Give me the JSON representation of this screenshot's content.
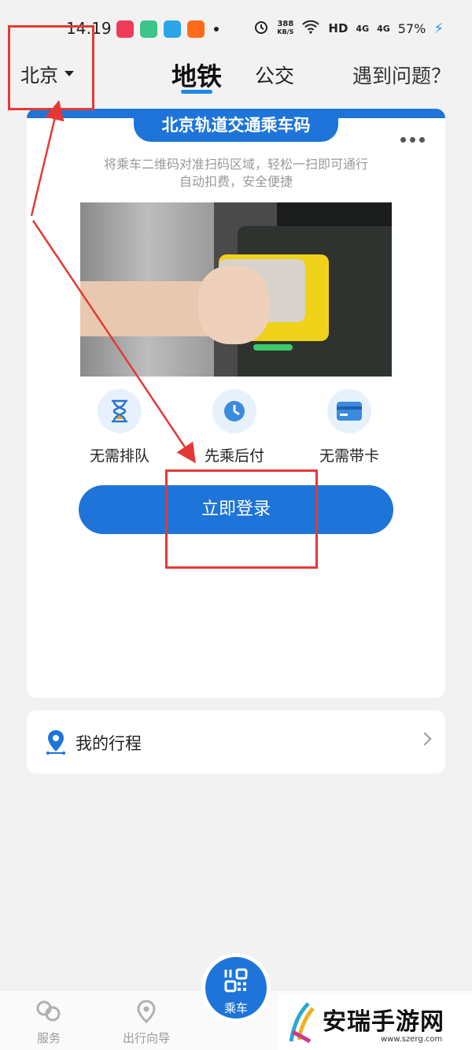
{
  "status_bar": {
    "time": "14:19",
    "speed_value": "388",
    "speed_unit": "KB/S",
    "network": "HD",
    "signal1": "4G",
    "signal2": "4G",
    "battery": "57%"
  },
  "header": {
    "city": "北京",
    "tabs": [
      {
        "label": "地铁",
        "active": true
      },
      {
        "label": "公交",
        "active": false
      }
    ],
    "help": "遇到问题？"
  },
  "card": {
    "banner": "北京轨道交通乘车码",
    "desc_line1": "将乘车二维码对准扫码区域，轻松一扫即可通行",
    "desc_line2": "自动扣费，安全便捷",
    "features": [
      {
        "label": "无需排队",
        "icon": "hourglass-icon"
      },
      {
        "label": "先乘后付",
        "icon": "clock-icon"
      },
      {
        "label": "无需带卡",
        "icon": "card-icon"
      }
    ],
    "login_button": "立即登录"
  },
  "trips": {
    "label": "我的行程"
  },
  "bottom_nav": {
    "items": [
      {
        "label": "服务",
        "icon": "service-icon"
      },
      {
        "label": "出行向导",
        "icon": "location-icon"
      }
    ],
    "center": {
      "label": "乘车",
      "icon": "qr-code-icon"
    }
  },
  "watermark": {
    "text": "安瑞手游网",
    "url": "www.szerg.com"
  },
  "colors": {
    "accent": "#1e74d8",
    "annotation": "#e53935"
  }
}
